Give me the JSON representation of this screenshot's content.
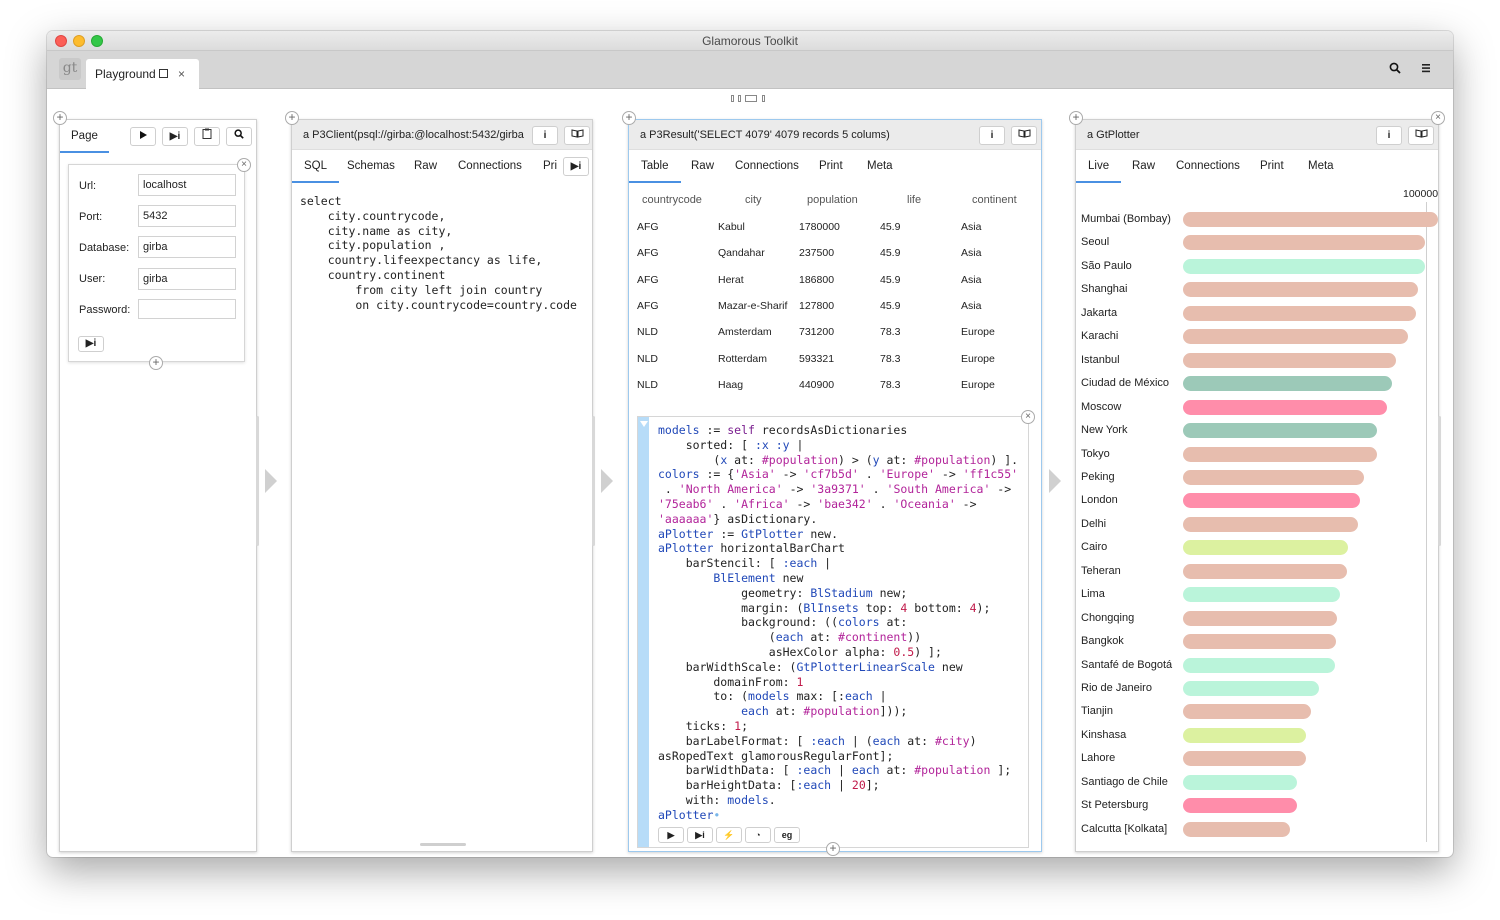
{
  "window": {
    "title": "Glamorous Toolkit"
  },
  "tabbar": {
    "logo": "gt",
    "tab_label": "Playground",
    "close_glyph": "×",
    "search_icon": "search-icon",
    "menu_icon": "hamburger-icon"
  },
  "pane1": {
    "tab": "Page",
    "fields": [
      {
        "label": "Url:",
        "value": "localhost"
      },
      {
        "label": "Port:",
        "value": "5432"
      },
      {
        "label": "Database:",
        "value": "girba"
      },
      {
        "label": "User:",
        "value": "girba"
      },
      {
        "label": "Password:",
        "value": ""
      }
    ]
  },
  "pane2": {
    "title": "a P3Client(psql://girba:@localhost:5432/girba",
    "tabs": [
      "SQL",
      "Schemas",
      "Raw",
      "Connections",
      "Pri"
    ],
    "sql": "select\n    city.countrycode,\n    city.name as city,\n    city.population ,\n    country.lifeexpectancy as life,\n    country.continent\n        from city left join country\n        on city.countrycode=country.code"
  },
  "pane3": {
    "title": "a P3Result('SELECT 4079' 4079 records 5 colums)",
    "tabs": [
      "Table",
      "Raw",
      "Connections",
      "Print",
      "Meta"
    ],
    "columns": [
      "countrycode",
      "city",
      "population",
      "life",
      "continent"
    ],
    "rows": [
      [
        "AFG",
        "Kabul",
        "1780000",
        "45.9",
        "Asia"
      ],
      [
        "AFG",
        "Qandahar",
        "237500",
        "45.9",
        "Asia"
      ],
      [
        "AFG",
        "Herat",
        "186800",
        "45.9",
        "Asia"
      ],
      [
        "AFG",
        "Mazar-e-Sharif",
        "127800",
        "45.9",
        "Asia"
      ],
      [
        "NLD",
        "Amsterdam",
        "731200",
        "78.3",
        "Europe"
      ],
      [
        "NLD",
        "Rotterdam",
        "593321",
        "78.3",
        "Europe"
      ],
      [
        "NLD",
        "Haag",
        "440900",
        "78.3",
        "Europe"
      ]
    ]
  },
  "pane4": {
    "title": "a GtPlotter",
    "tabs": [
      "Live",
      "Raw",
      "Connections",
      "Print",
      "Meta"
    ],
    "axis_max_label": "100000",
    "colors": {
      "Asia": "#cf7b5d",
      "Europe": "#ff1c55",
      "North America": "#3a9371",
      "South America": "#75eab6",
      "Africa": "#bae342",
      "Oceania": "#aaaaaa"
    }
  },
  "chart_data": {
    "type": "bar",
    "orientation": "horizontal",
    "title": "",
    "xlabel": "",
    "ylabel": "",
    "xlim": [
      0,
      10500000
    ],
    "tick_labels": [
      "100000"
    ],
    "categories": [
      "Mumbai (Bombay)",
      "Seoul",
      "São Paulo",
      "Shanghai",
      "Jakarta",
      "Karachi",
      "Istanbul",
      "Ciudad de México",
      "Moscow",
      "New York",
      "Tokyo",
      "Peking",
      "London",
      "Delhi",
      "Cairo",
      "Teheran",
      "Lima",
      "Chongqing",
      "Bangkok",
      "Santafé de Bogotá",
      "Rio de Janeiro",
      "Tianjin",
      "Kinshasa",
      "Lahore",
      "Santiago de Chile",
      "St Petersburg",
      "Calcutta [Kolkata]"
    ],
    "values": [
      10500000,
      9981619,
      9968485,
      9696300,
      9604900,
      9269265,
      8787958,
      8591309,
      8389200,
      8008278,
      7980230,
      7472000,
      7285000,
      7206704,
      6789479,
      6758845,
      6464693,
      6351600,
      6320174,
      6260862,
      5598953,
      5286800,
      5064000,
      5063499,
      4703954,
      4694000,
      4399819
    ],
    "series_colors": [
      "#e7bdae",
      "#e7bdae",
      "#baf4da",
      "#e7bdae",
      "#e7bdae",
      "#e7bdae",
      "#e7bdae",
      "#9cc9b8",
      "#ff8daa",
      "#9cc9b8",
      "#e7bdae",
      "#e7bdae",
      "#ff8daa",
      "#e7bdae",
      "#dcf1a0",
      "#e7bdae",
      "#baf4da",
      "#e7bdae",
      "#e7bdae",
      "#baf4da",
      "#baf4da",
      "#e7bdae",
      "#dcf1a0",
      "#e7bdae",
      "#baf4da",
      "#ff8daa",
      "#e7bdae"
    ]
  }
}
